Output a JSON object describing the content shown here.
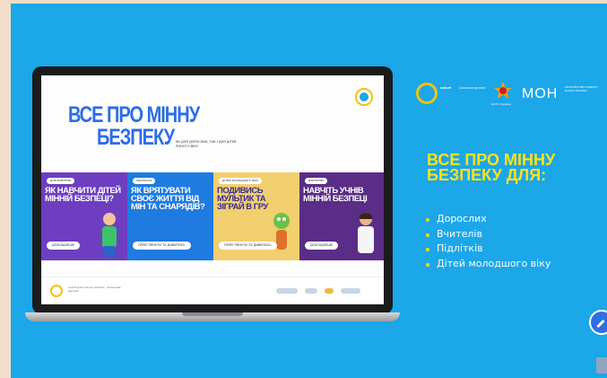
{
  "hero": {
    "title_line1": "ВСЕ ПРО МІННУ",
    "title_line2": "БЕЗПЕКУ",
    "subtitle": "ЯК ДЛЯ ДОРОСЛИХ, ТАК І ДЛЯ ДІТЕЙ РІЗНОГО ВІКУ"
  },
  "cards": [
    {
      "tag": "ДЛЯ ВЧИТЕЛІВ",
      "title": "ЯК НАВЧИТИ ДІТЕЙ МІННІЙ БЕЗПЕЦІ?",
      "button": "ДОКЛАДНІШЕ"
    },
    {
      "tag": "ПІДЛІТКАМ",
      "title": "ЯК ВРЯТУВАТИ СВОЄ ЖИТТЯ ВІД МІН ТА СНАРЯДІВ?",
      "button": "ПЕРЕГЛЯНУТИ ТА ДИВИТИСЬ"
    },
    {
      "tag": "ДІТЯМ МОЛОДШОГО ВІКУ",
      "title": "ПОДИВИСЬ МУЛЬТИК ТА ЗІГРАЙ В ГРУ",
      "button": "ПЕРЕГЛЯНУТИ ТА ДИВИТИСЬ"
    },
    {
      "tag": "ВЧИТЕЛЯМ",
      "title": "НАВЧІТЬ УЧНІВ МІННІЙ БЕЗПЕЦІ",
      "button": "ДОКЛАДНІШЕ"
    }
  ],
  "footer": {
    "text": "unicef для кожної дитини · Сильніша дитина"
  },
  "partners": {
    "unicef": "unicef",
    "unicef_caption": "Сильніша дитина",
    "dsns_caption": "ДСНС України",
    "mon_logo": "МОН",
    "mon_caption": "МІНІСТЕРСТВО ОСВІТИ І НАУКИ УКРАЇНИ"
  },
  "right": {
    "title": "ВСЕ ПРО МІННУ БЕЗПЕКУ ДЛЯ:",
    "items": [
      "Дорослих",
      "Вчителів",
      "Підлітків",
      "Дітей молодшого віку"
    ]
  },
  "colors": {
    "background": "#1ba7e8",
    "accent_yellow": "#ffe21a",
    "hero_blue": "#2c6de8"
  }
}
